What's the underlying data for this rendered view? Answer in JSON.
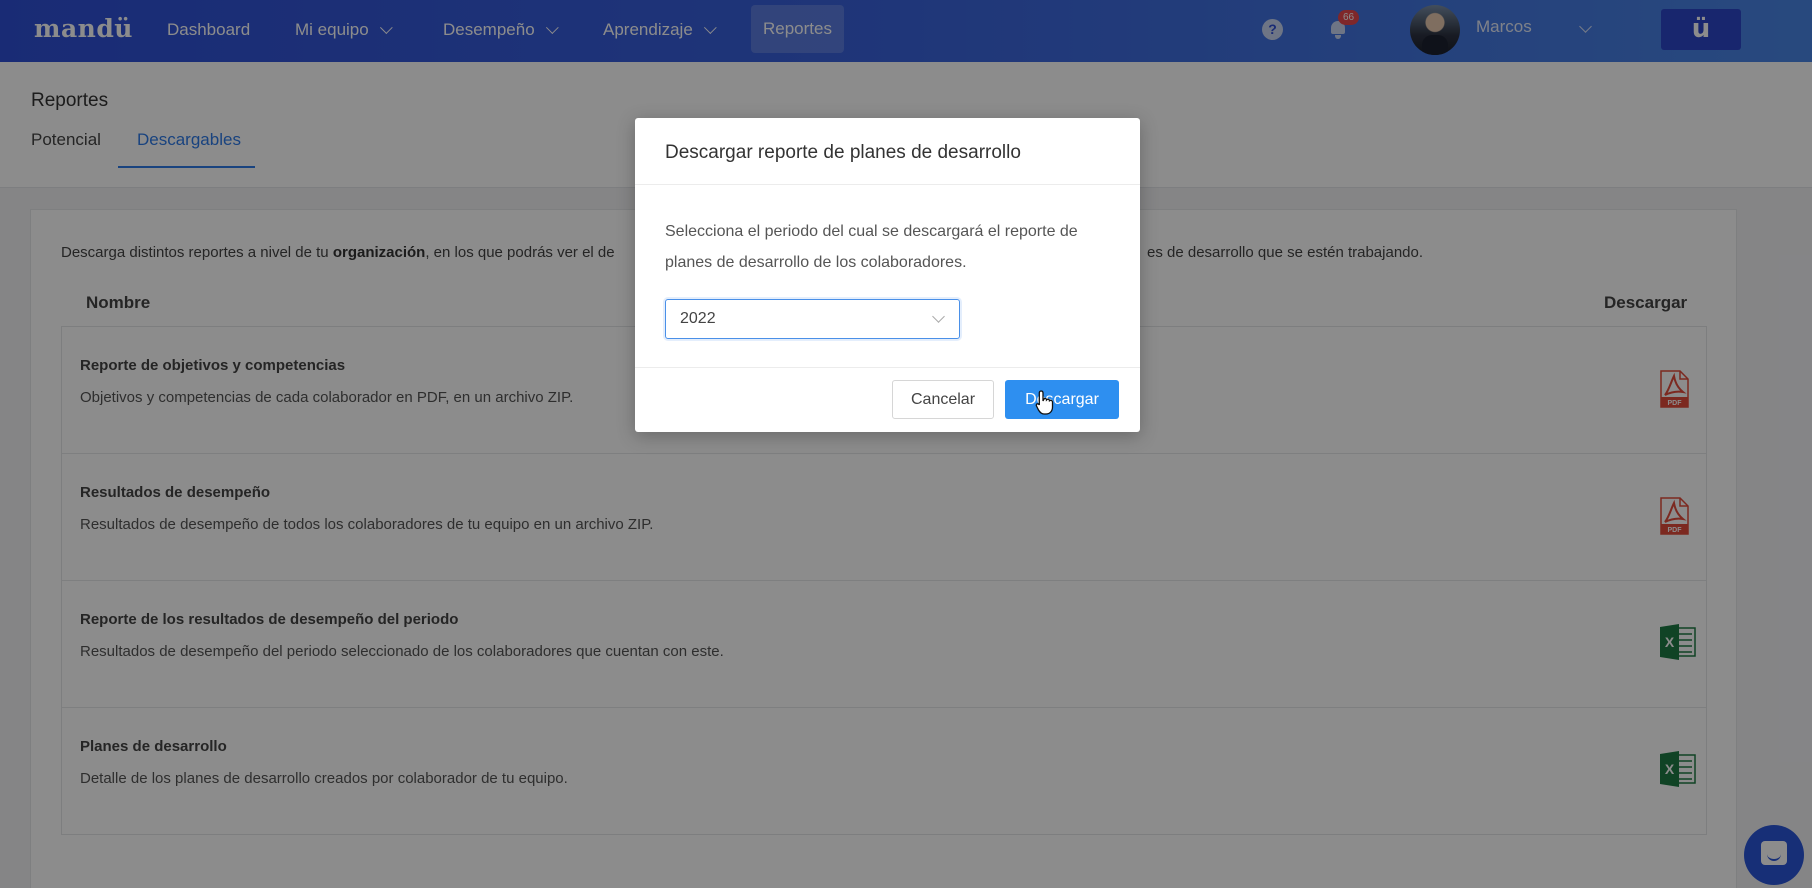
{
  "nav": {
    "logo": "mandü",
    "items": [
      {
        "label": "Dashboard"
      },
      {
        "label": "Mi equipo"
      },
      {
        "label": "Desempeño"
      },
      {
        "label": "Aprendizaje"
      },
      {
        "label": "Reportes"
      }
    ],
    "notification_count": "66",
    "help_symbol": "?",
    "user_name": "Marcos",
    "brand_mark": "ü"
  },
  "page": {
    "title": "Reportes",
    "tabs": [
      {
        "label": "Potencial"
      },
      {
        "label": "Descargables"
      }
    ],
    "intro_prefix": "Descarga distintos reportes a nivel de tu ",
    "intro_bold": "organización",
    "intro_suffix": ", en los que podrás ver el de",
    "intro_tail": "es de desarrollo que se estén trabajando.",
    "col_name": "Nombre",
    "col_download": "Descargar",
    "rows": [
      {
        "title": "Reporte de objetivos y competencias",
        "desc": "Objetivos y competencias de cada colaborador en PDF, en un archivo ZIP.",
        "icon": "pdf-icon"
      },
      {
        "title": "Resultados de desempeño",
        "desc": "Resultados de desempeño de todos los colaboradores de tu equipo en un archivo ZIP.",
        "icon": "pdf-icon"
      },
      {
        "title": "Reporte de los resultados de desempeño del periodo",
        "desc": "Resultados de desempeño del periodo seleccionado de los colaboradores que cuentan con este.",
        "icon": "excel-icon"
      },
      {
        "title": "Planes de desarrollo",
        "desc": "Detalle de los planes de desarrollo creados por colaborador de tu equipo.",
        "icon": "excel-icon"
      }
    ]
  },
  "modal": {
    "title": "Descargar reporte de planes de desarrollo",
    "body": "Selecciona el periodo del cual se descargará el reporte de planes de desarrollo de los colaboradores.",
    "select_value": "2022",
    "cancel_label": "Cancelar",
    "download_label": "Descargar"
  },
  "colors": {
    "nav_gradient_start": "#2f4fd6",
    "nav_gradient_end": "#4a86e6",
    "accent": "#2f7be8",
    "primary_button": "#2e8ff0",
    "pdf_red": "#e24b3b",
    "excel_green": "#1e7a44"
  }
}
